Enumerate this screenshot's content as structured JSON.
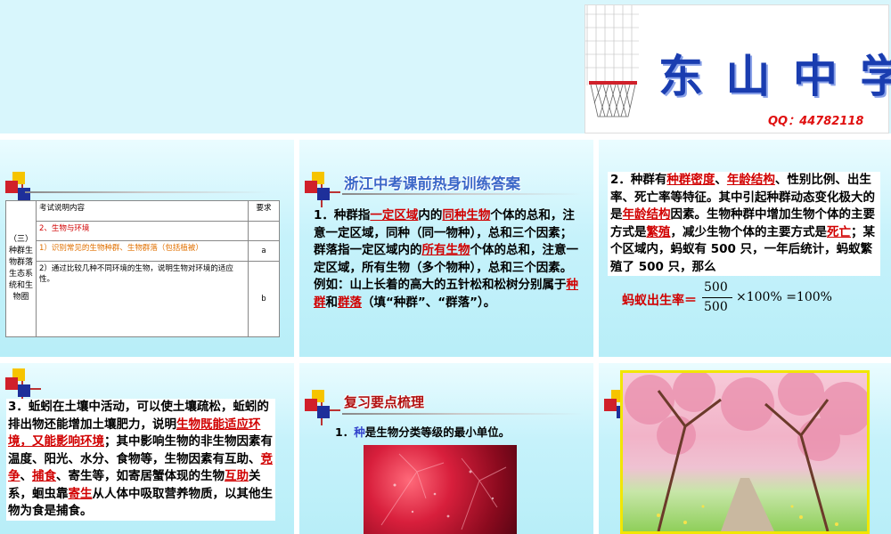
{
  "slide1": {
    "brand": "东 山 中 学",
    "qq": "QQ：44782118"
  },
  "slide2": {
    "table": {
      "header_content": "考试说明内容",
      "header_req": "要求",
      "section": "（三）种群生物群落生态系统和生物圈",
      "row1": "2、生物与环境",
      "row2": "1）识别常见的生物种群、生物群落（包括植被）",
      "row2_req": "a",
      "row3": "2）通过比较几种不同环境的生物，说明生物对环境的适应性。",
      "row3_req": "b"
    }
  },
  "slide3": {
    "title": "浙江中考课前热身训练答案",
    "p1": "1．种群指",
    "a1": "一定区域",
    "p2": "内的",
    "a2": "同种生物",
    "p3": "个体的总和，注意一定区域，同种（同一物种），总和三个因素；群落指一定区域内的",
    "a3": "所有生物",
    "p4": "个体的总和，注意一定区域，所有生物（多个物种），总和三个因素。例如：山上长着的高大的五针松和松树分别属于",
    "a4": "种群",
    "p5": "和",
    "a5": "群落",
    "p6": "（填“种群”、“群落”）。"
  },
  "slide4": {
    "p1": "2．种群有",
    "a1": "种群密度",
    "p2": "、",
    "a2": "年龄结构",
    "p3": "、性别比例、出生率、死亡率等特征。其中引起种群动态变化极大的是",
    "a3": "年龄结构",
    "p4": "因素。生物种群中增加生物个体的主要方式是",
    "a4": "繁殖",
    "p5": "，减少生物个体的主要方式是",
    "a5": "死亡",
    "p6": "；某个区域内，蚂蚁有 500 只，一年后统计，蚂蚁繁殖了 500 只，那么",
    "formula_label": "蚂蚁出生率＝",
    "numerator": "500",
    "denominator": "500",
    "formula_rest": "×100% =100%"
  },
  "slide5": {
    "p1": "3．蚯蚓在土壤中活动，可以使土壤疏松，蚯蚓的排出物还能增加土壤肥力，说明",
    "a1": "生物既能适应环境，又能影响环境",
    "p2": "；其中影响生物的非生物因素有温度、阳光、水分、食物等，生物因素有互助、",
    "a2": "竞争",
    "sep": "、",
    "a3": "捕食",
    "p3": "、寄生等，如寄居蟹体现的生物",
    "a4": "互助",
    "p4": "关系，蛔虫靠",
    "a5": "寄生",
    "p5": "从人体中吸取营养物质，以其他生物为食是捕食。"
  },
  "slide6": {
    "title": "复习要点梳理",
    "p1": "1．",
    "a1": "种",
    "p2": "是生物分类等级的最小单位。"
  },
  "colors": {
    "answer_red": "#d10000",
    "slide_bg": "#c6f2fb",
    "title_blue": "#3b67c8"
  }
}
